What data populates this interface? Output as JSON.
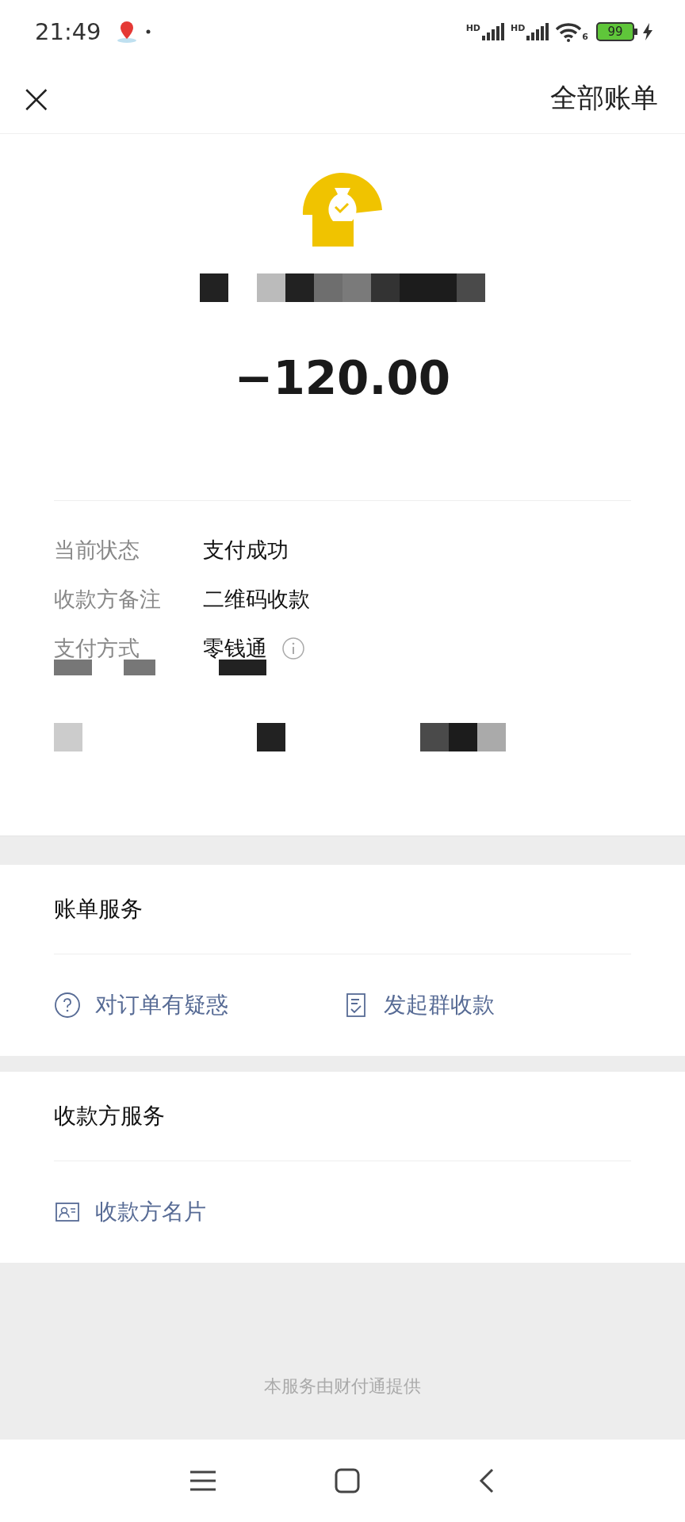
{
  "status_bar": {
    "time": "21:49",
    "signals": [
      {
        "label": "HD"
      },
      {
        "label": "HD"
      }
    ],
    "wifi_label": "6",
    "battery": "99",
    "charging": true
  },
  "header": {
    "close": "×",
    "title": "全部账单"
  },
  "summary": {
    "amount": "−120.00"
  },
  "details": [
    {
      "label": "当前状态",
      "value": "支付成功",
      "info": false
    },
    {
      "label": "收款方备注",
      "value": "二维码收款",
      "info": false
    },
    {
      "label": "支付方式",
      "value": "零钱通",
      "info": true
    }
  ],
  "sections": [
    {
      "title": "账单服务",
      "links": [
        {
          "kind": "question",
          "label": "对订单有疑惑"
        },
        {
          "kind": "receipt",
          "label": "发起群收款"
        }
      ]
    },
    {
      "title": "收款方服务",
      "links": [
        {
          "kind": "card",
          "label": "收款方名片"
        }
      ]
    }
  ],
  "footer": "本服务由财付通提供"
}
